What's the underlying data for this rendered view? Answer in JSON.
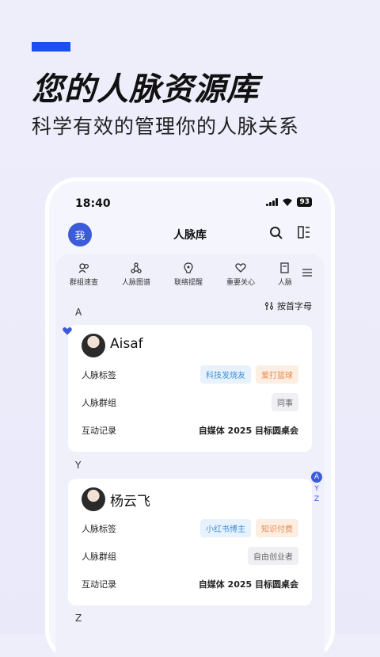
{
  "promo": {
    "headline": "您的人脉资源库",
    "subline": "科学有效的管理你的人脉关系",
    "accent_color": "#1a4ff0"
  },
  "status_bar": {
    "time": "18:40",
    "battery": "93"
  },
  "nav": {
    "avatar_label": "我",
    "title": "人脉库",
    "icons": [
      "search-icon",
      "layout-icon"
    ]
  },
  "tabs": [
    {
      "label": "群组速查",
      "icon": "group-icon"
    },
    {
      "label": "人脉图谱",
      "icon": "graph-icon"
    },
    {
      "label": "联络提醒",
      "icon": "reminder-icon"
    },
    {
      "label": "重要关心",
      "icon": "heart-icon"
    },
    {
      "label": "人脉",
      "icon": "doc-icon"
    }
  ],
  "sort_label": "按首字母",
  "sections": [
    {
      "letter": "A",
      "contact": {
        "name": "Aisaf",
        "favorite": true,
        "rows": {
          "tags_label": "人脉标签",
          "tags": [
            {
              "text": "科技发烧友",
              "color": "blue"
            },
            {
              "text": "爱打篮球",
              "color": "orange"
            }
          ],
          "group_label": "人脉群组",
          "group": "同事",
          "interaction_label": "互动记录",
          "interaction": "自媒体 2025 目标圆桌会"
        }
      }
    },
    {
      "letter": "Y",
      "contact": {
        "name": "杨云飞",
        "favorite": false,
        "rows": {
          "tags_label": "人脉标签",
          "tags": [
            {
              "text": "小红书博主",
              "color": "blue"
            },
            {
              "text": "知识付费",
              "color": "orange"
            }
          ],
          "group_label": "人脉群组",
          "group": "自由创业者",
          "interaction_label": "互动记录",
          "interaction": "自媒体 2025 目标圆桌会"
        }
      }
    },
    {
      "letter": "Z"
    }
  ],
  "index_bar": [
    "A",
    "Y",
    "Z"
  ],
  "index_selected": "A"
}
